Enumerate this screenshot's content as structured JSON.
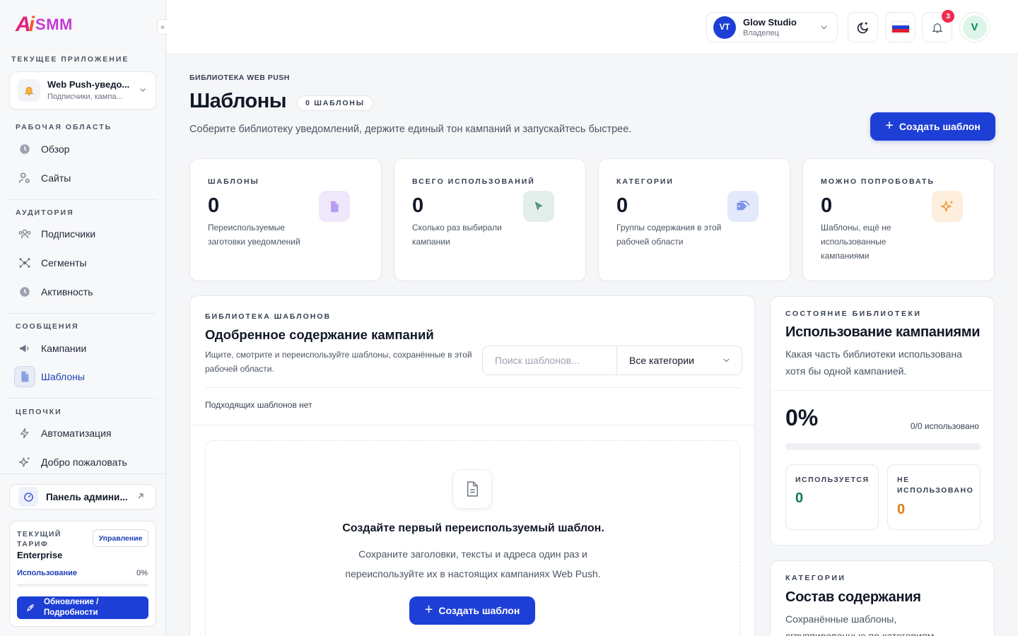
{
  "brand": {
    "logo_text": "AiSMM"
  },
  "sidebar": {
    "current_app_label": "ТЕКУЩЕЕ ПРИЛОЖЕНИЕ",
    "app": {
      "title": "Web Push-уведо...",
      "subtitle": "Подписчики, кампа..."
    },
    "sections": {
      "workspace": "РАБОЧАЯ ОБЛАСТЬ",
      "audience": "АУДИТОРИЯ",
      "messages": "СООБЩЕНИЯ",
      "chains": "ЦЕПОЧКИ"
    },
    "items": {
      "overview": "Обзор",
      "sites": "Сайты",
      "subscribers": "Подписчики",
      "segments": "Сегменты",
      "activity": "Активность",
      "campaigns": "Кампании",
      "templates": "Шаблоны",
      "automation": "Автоматизация",
      "welcome": "Добро пожаловать"
    },
    "admin_panel": "Панель админи...",
    "plan": {
      "label": "ТЕКУЩИЙ ТАРИФ",
      "name": "Enterprise",
      "manage": "Управление",
      "usage_label": "Использование",
      "usage_value": "0%",
      "upgrade": "Обновление / Подробности"
    }
  },
  "topbar": {
    "account": {
      "initials": "VT",
      "name": "Glow Studio",
      "role": "Владелец"
    },
    "notifications_count": "3",
    "user_initial": "V"
  },
  "page": {
    "breadcrumb": "БИБЛИОТЕКА WEB PUSH",
    "title": "Шаблоны",
    "count_pill": "0 ШАБЛОНЫ",
    "description": "Соберите библиотеку уведомлений, держите единый тон кампаний и запускайтесь быстрее.",
    "create_button": "Создать шаблон"
  },
  "stats": [
    {
      "label": "ШАБЛОНЫ",
      "value": "0",
      "desc": "Переиспользуемые заготовки уведомлений",
      "icon": "document-icon",
      "color": "#8b5cf6"
    },
    {
      "label": "ВСЕГО ИСПОЛЬЗОВАНИЙ",
      "value": "0",
      "desc": "Сколько раз выбирали кампании",
      "icon": "cursor-icon",
      "color": "#2f7d6d"
    },
    {
      "label": "КАТЕГОРИИ",
      "value": "0",
      "desc": "Группы содержания в этой рабочей области",
      "icon": "tag-icon",
      "color": "#4f6fe0"
    },
    {
      "label": "МОЖНО ПОПРОБОВАТЬ",
      "value": "0",
      "desc": "Шаблоны, ещё не использованные кампаниями",
      "icon": "sparkle-icon",
      "color": "#f08a24"
    }
  ],
  "library": {
    "eyebrow": "БИБЛИОТЕКА ШАБЛОНОВ",
    "title": "Одобренное содержание кампаний",
    "description": "Ищите, смотрите и переиспользуйте шаблоны, сохранённые в этой рабочей области.",
    "search_placeholder": "Поиск шаблонов...",
    "category_selected": "Все категории",
    "no_match": "Подходящих шаблонов нет",
    "empty": {
      "title": "Создайте первый переиспользуемый шаблон.",
      "description": "Сохраните заголовки, тексты и адреса один раз и переиспользуйте их в настоящих кампаниях Web Push.",
      "button": "Создать шаблон"
    }
  },
  "library_status": {
    "eyebrow": "СОСТОЯНИЕ БИБЛИОТЕКИ",
    "title": "Использование кампаниями",
    "description": "Какая часть библиотеки использована хотя бы одной кампанией.",
    "percent": "0%",
    "progress": 0,
    "ratio": "0/0 использовано",
    "used_label": "ИСПОЛЬЗУЕТСЯ",
    "used_value": "0",
    "unused_label": "НЕ ИСПОЛЬЗОВАНО",
    "unused_value": "0",
    "used_color": "#0f7a5c",
    "unused_color": "#e07b12"
  },
  "categories": {
    "eyebrow": "КАТЕГОРИИ",
    "title": "Состав содержания",
    "description": "Сохранённые шаблоны, сгруппированные по категориям"
  }
}
